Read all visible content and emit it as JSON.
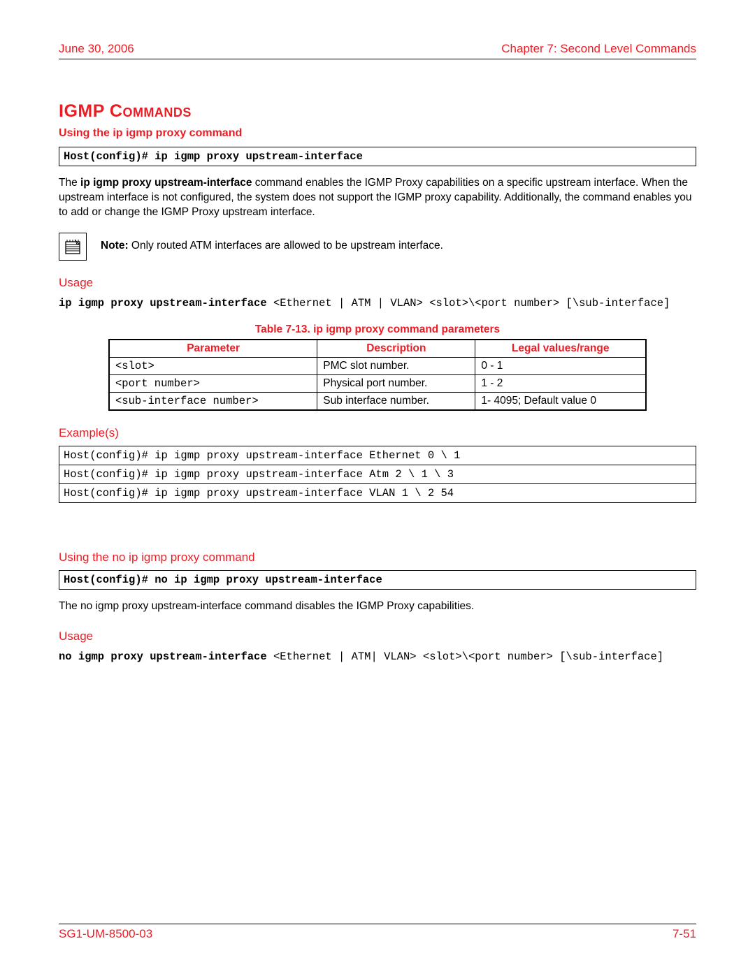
{
  "header": {
    "date": "June 30, 2006",
    "chapter": "Chapter 7: Second Level Commands"
  },
  "section_heading": "IGMP Commands",
  "cmd1": {
    "title": "Using the ip igmp proxy command",
    "syntax_box": "Host(config)# ip igmp proxy upstream-interface",
    "desc_prefix": "The ",
    "desc_bold": "ip igmp proxy upstream-interface",
    "desc_rest": " command enables the IGMP Proxy capabilities on a specific upstream interface. When the upstream interface is not configured, the system does not support the IGMP proxy capability. Additionally, the command enables you to add or change the IGMP Proxy upstream interface.",
    "note_label": "Note:",
    "note_text": " Only routed ATM interfaces are allowed to be upstream interface.",
    "usage_label": "Usage",
    "usage_bold": "ip igmp proxy upstream-interface ",
    "usage_plain": "<Ethernet | ATM | VLAN> <slot>\\<port number> [\\sub-interface]",
    "table_caption": "Table 7-13. ip igmp proxy command parameters",
    "table_headers": {
      "p": "Parameter",
      "d": "Description",
      "l": "Legal values/range"
    },
    "table_rows": [
      {
        "p": "<slot>",
        "d": "PMC slot number.",
        "l": "0 - 1"
      },
      {
        "p": "<port number>",
        "d": "Physical port number.",
        "l": "1 - 2"
      },
      {
        "p": "<sub-interface number>",
        "d": "Sub interface number.",
        "l": "1- 4095; Default value 0"
      }
    ],
    "examples_label": "Example(s)",
    "examples": [
      "Host(config)# ip igmp proxy upstream-interface Ethernet 0 \\ 1",
      "Host(config)# ip igmp proxy upstream-interface Atm 2 \\ 1 \\ 3",
      "Host(config)# ip igmp proxy upstream-interface VLAN 1 \\ 2 54"
    ]
  },
  "cmd2": {
    "title": "Using the no ip igmp proxy command",
    "syntax_box": "Host(config)# no ip igmp proxy upstream-interface",
    "desc": "The no igmp proxy upstream-interface command disables the IGMP Proxy capabilities.",
    "usage_label": "Usage",
    "usage_bold": "no igmp proxy upstream-interface ",
    "usage_plain": "<Ethernet | ATM| VLAN> <slot>\\<port number> [\\sub-interface]"
  },
  "footer": {
    "doc_id": "SG1-UM-8500-03",
    "page": "7-51"
  }
}
